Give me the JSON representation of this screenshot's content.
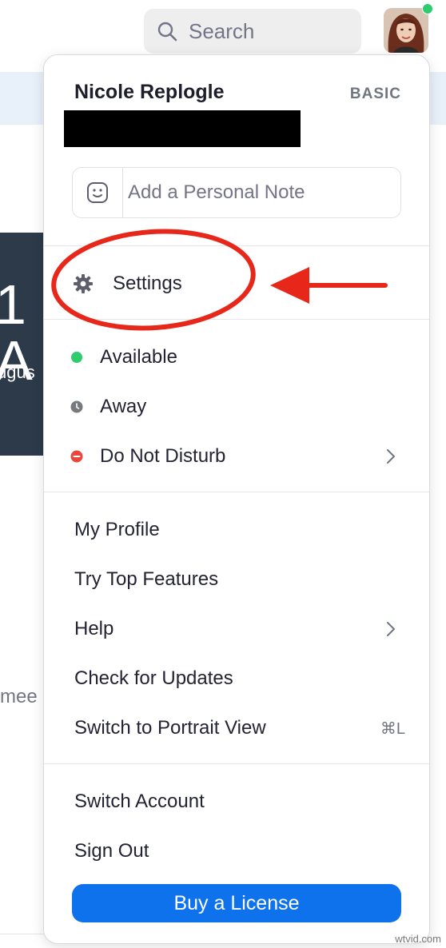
{
  "header": {
    "search_label": "Search",
    "search_icon": "magnifier-icon",
    "avatar_icon": "user-avatar",
    "status_color": "#2fcc6f"
  },
  "background": {
    "card_big_text": "1 A",
    "card_month": "ugus",
    "meeting_text": "mee"
  },
  "menu": {
    "user_name": "Nicole Replogle",
    "plan": "BASIC",
    "note_placeholder": "Add a Personal Note",
    "note_icon": "smiley-icon",
    "settings": {
      "label": "Settings",
      "icon": "gear-icon"
    },
    "statuses": [
      {
        "label": "Available",
        "color": "#2fcc6f",
        "icon": "status-available-dot"
      },
      {
        "label": "Away",
        "color": "#76797e",
        "icon": "clock-icon"
      },
      {
        "label": "Do Not Disturb",
        "color": "#e8473b",
        "icon": "do-not-disturb-icon",
        "trailing": "chevron-right-icon"
      }
    ],
    "items": [
      {
        "label": "My Profile"
      },
      {
        "label": "Try Top Features"
      },
      {
        "label": "Help",
        "trailing": "chevron-right-icon"
      },
      {
        "label": "Check for Updates"
      },
      {
        "label": "Switch to Portrait View",
        "shortcut": "⌘L"
      }
    ],
    "account_items": [
      {
        "label": "Switch Account"
      },
      {
        "label": "Sign Out"
      }
    ],
    "buy_button": "Buy a License",
    "accent": "#0e72ed"
  },
  "annotation": {
    "color": "#e8271b"
  },
  "watermark": "wtvid.com"
}
